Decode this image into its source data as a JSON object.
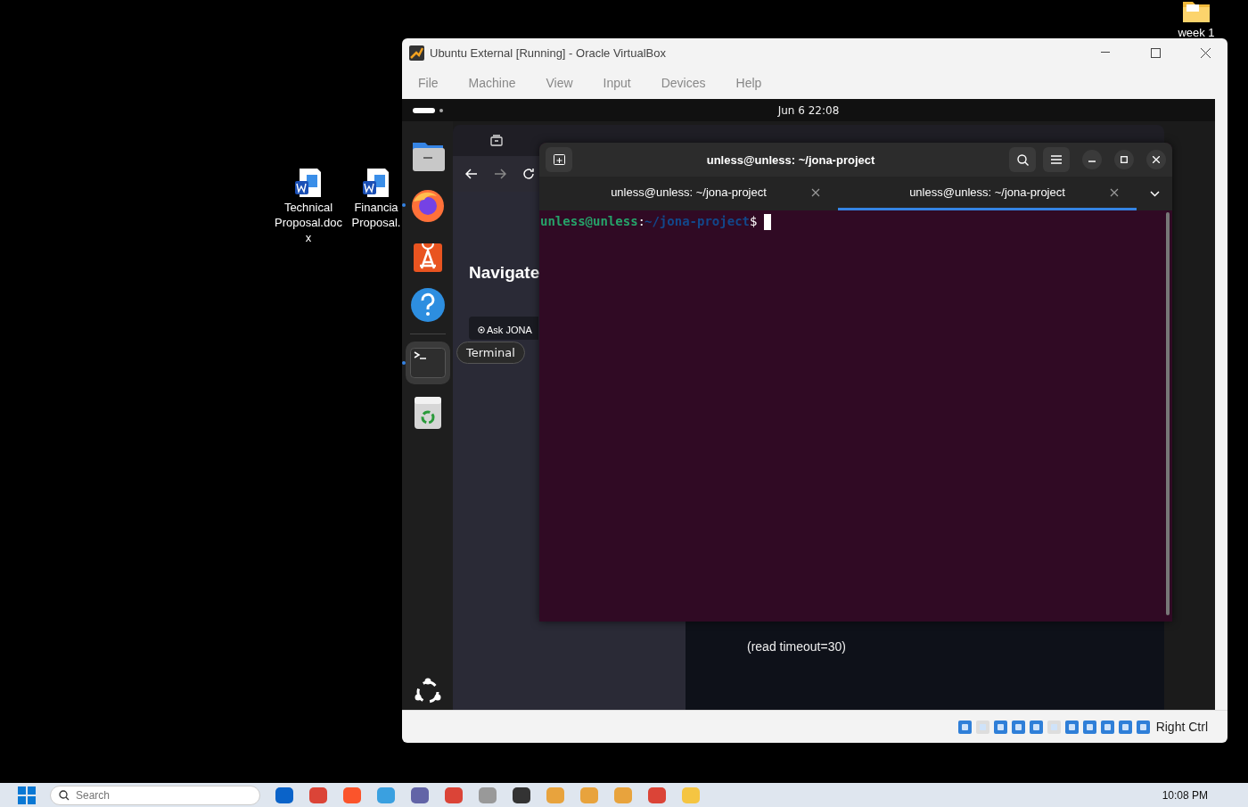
{
  "desktop": {
    "icons": [
      {
        "kind": "word",
        "label": "Technical Proposal.docx"
      },
      {
        "kind": "word",
        "label": "Financia Proposal."
      },
      {
        "kind": "folder",
        "label": "week 1"
      }
    ]
  },
  "vbox": {
    "title": "Ubuntu External [Running] - Oracle VirtualBox",
    "menu": [
      "File",
      "Machine",
      "View",
      "Input",
      "Devices",
      "Help"
    ],
    "host_key": "Right Ctrl"
  },
  "guest": {
    "clock": "Jun 6  22:08",
    "dock": [
      {
        "kind": "files",
        "running": false,
        "selected": false
      },
      {
        "kind": "firefox",
        "running": true,
        "selected": false
      },
      {
        "kind": "appcenter",
        "running": false,
        "selected": false
      },
      {
        "kind": "help",
        "running": false,
        "selected": false
      },
      {
        "kind": "terminal",
        "running": true,
        "selected": true
      },
      {
        "kind": "trash",
        "running": false,
        "selected": false
      }
    ],
    "tooltip": "Terminal",
    "browser": {
      "heading": "Navigate",
      "ask_button": "Ask JONA",
      "output": "(read timeout=30)"
    },
    "terminal": {
      "title": "unless@unless: ~/jona-project",
      "tabs": [
        {
          "label": "unless@unless: ~/jona-project",
          "selected": false
        },
        {
          "label": "unless@unless: ~/jona-project",
          "selected": true
        }
      ],
      "prompt": {
        "user": "unless@unless",
        "separator": ":",
        "path": "~/jona-project",
        "symbol": "$"
      }
    }
  },
  "taskbar": {
    "search": {
      "placeholder": "Search"
    },
    "time": "10:08 PM"
  }
}
